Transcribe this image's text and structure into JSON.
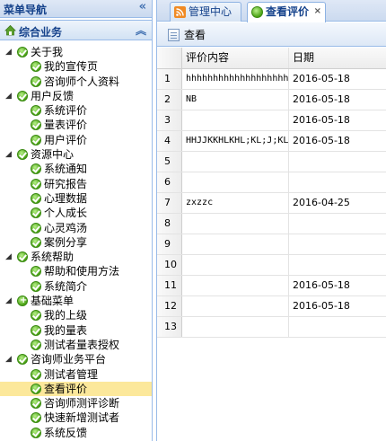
{
  "left_panel": {
    "title": "菜单导航",
    "accordion_title": "综合业务",
    "tree": [
      {
        "label": "关于我",
        "level": 1,
        "children": [
          {
            "label": "我的宣传页"
          },
          {
            "label": "咨询师个人资料"
          }
        ]
      },
      {
        "label": "用户反馈",
        "level": 1,
        "children": [
          {
            "label": "系统评价"
          },
          {
            "label": "量表评价"
          },
          {
            "label": "用户评价"
          }
        ]
      },
      {
        "label": "资源中心",
        "level": 1,
        "children": [
          {
            "label": "系统通知"
          },
          {
            "label": "研究报告"
          },
          {
            "label": "心理数据"
          },
          {
            "label": "个人成长"
          },
          {
            "label": "心灵鸡汤"
          },
          {
            "label": "案例分享"
          }
        ]
      },
      {
        "label": "系统帮助",
        "level": 1,
        "children": [
          {
            "label": "帮助和使用方法"
          },
          {
            "label": "系统简介"
          }
        ]
      },
      {
        "label": "基础菜单",
        "level": 1,
        "children": [
          {
            "label": "我的上级"
          },
          {
            "label": "我的量表"
          },
          {
            "label": "测试者量表授权"
          }
        ]
      },
      {
        "label": "咨询师业务平台",
        "level": 1,
        "children": [
          {
            "label": "测试者管理"
          },
          {
            "label": "查看评价",
            "selected": true
          },
          {
            "label": "咨询师测评诊断"
          },
          {
            "label": "快速新增测试者"
          },
          {
            "label": "系统反馈"
          }
        ]
      }
    ]
  },
  "tabs": [
    {
      "label": "管理中心",
      "active": false
    },
    {
      "label": "查看评价",
      "active": true,
      "closable": true
    }
  ],
  "toolbar": {
    "view_label": "查看"
  },
  "grid": {
    "columns": [
      "评价内容",
      "日期"
    ],
    "rows": [
      {
        "num": "1",
        "content": "hhhhhhhhhhhhhhhhhhhhhhhhhh",
        "date": "2016-05-18"
      },
      {
        "num": "2",
        "content": "NB",
        "date": "2016-05-18"
      },
      {
        "num": "3",
        "content": "",
        "date": "2016-05-18"
      },
      {
        "num": "4",
        "content": "HHJJKKHLKHL;KL;J;KL;",
        "date": "2016-05-18"
      },
      {
        "num": "5",
        "content": "",
        "date": ""
      },
      {
        "num": "6",
        "content": "",
        "date": ""
      },
      {
        "num": "7",
        "content": "zxzzc",
        "date": "2016-04-25"
      },
      {
        "num": "8",
        "content": "",
        "date": ""
      },
      {
        "num": "9",
        "content": "",
        "date": ""
      },
      {
        "num": "10",
        "content": "",
        "date": ""
      },
      {
        "num": "11",
        "content": "",
        "date": "2016-05-18"
      },
      {
        "num": "12",
        "content": "",
        "date": "2016-05-18"
      },
      {
        "num": "13",
        "content": "",
        "date": ""
      }
    ]
  },
  "icons": {
    "collapse": "double-chevron-left-icon",
    "accordion": "home-icon",
    "node": "green-check-icon",
    "tab_manage": "rss-icon",
    "tab_review": "green-check-icon",
    "view": "document-icon"
  },
  "colors": {
    "accent": "#15428b",
    "selected_bg": "#fce89b",
    "panel_border": "#99bbe8"
  }
}
